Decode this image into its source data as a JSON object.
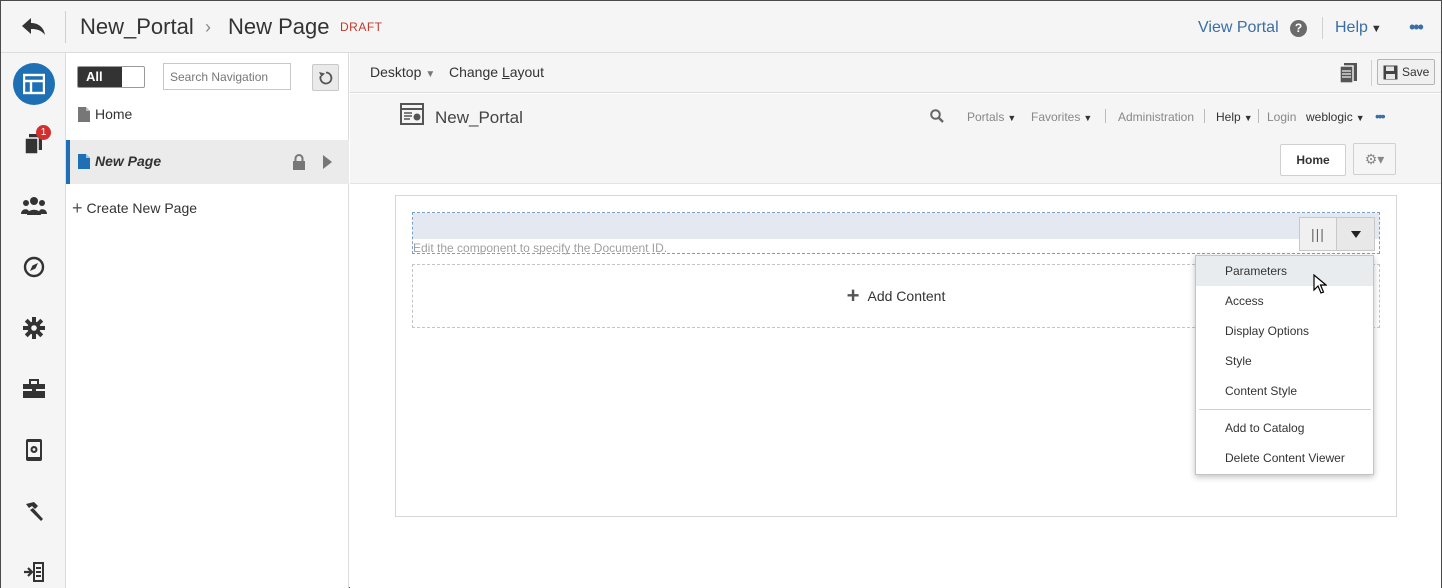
{
  "header": {
    "breadcrumb_portal": "New_Portal",
    "breadcrumb_separator": "›",
    "breadcrumb_page": "New Page",
    "status": "DRAFT",
    "view_portal": "View Portal",
    "help_icon_text": "?",
    "help": "Help",
    "more": "•••"
  },
  "rail": {
    "items": [
      {
        "icon": "pages-layout-icon",
        "active": true
      },
      {
        "icon": "assets-icon",
        "badge": "1"
      },
      {
        "icon": "people-icon"
      },
      {
        "icon": "compass-icon"
      },
      {
        "icon": "gear-icon"
      },
      {
        "icon": "toolbox-icon"
      },
      {
        "icon": "device-settings-icon"
      },
      {
        "icon": "hammer-icon"
      },
      {
        "icon": "import-export-icon"
      }
    ],
    "badge_count": "1"
  },
  "nav": {
    "toggle_label": "All",
    "search_placeholder": "Search Navigation",
    "items": [
      {
        "label": "Home"
      },
      {
        "label": "New Page",
        "selected": true
      }
    ],
    "create_label": "Create New Page",
    "create_plus": "+"
  },
  "toolbar": {
    "device": "Desktop",
    "change_layout_prefix": "Change ",
    "change_layout_underlined": "L",
    "change_layout_suffix": "ayout",
    "save": "Save"
  },
  "portal": {
    "name": "New_Portal",
    "nav": {
      "portals": "Portals",
      "favorites": "Favorites",
      "administration": "Administration",
      "help": "Help",
      "login": "Login",
      "user": "weblogic",
      "more": "•••"
    },
    "home_tab": "Home",
    "gear_symbol": "⚙▾"
  },
  "content_viewer": {
    "hint": "Edit the component to specify the Document ID.",
    "columns_symbol": "|||",
    "add_content": "Add Content",
    "add_plus": "+"
  },
  "menu": {
    "items": [
      "Parameters",
      "Access",
      "Display Options",
      "Style",
      "Content Style",
      "Add to Catalog",
      "Delete Content Viewer"
    ],
    "hovered": "Parameters"
  },
  "colors": {
    "accent": "#1f6fb5",
    "link": "#3a6ea5",
    "draft": "#c0392b",
    "badge": "#d32f2f"
  }
}
